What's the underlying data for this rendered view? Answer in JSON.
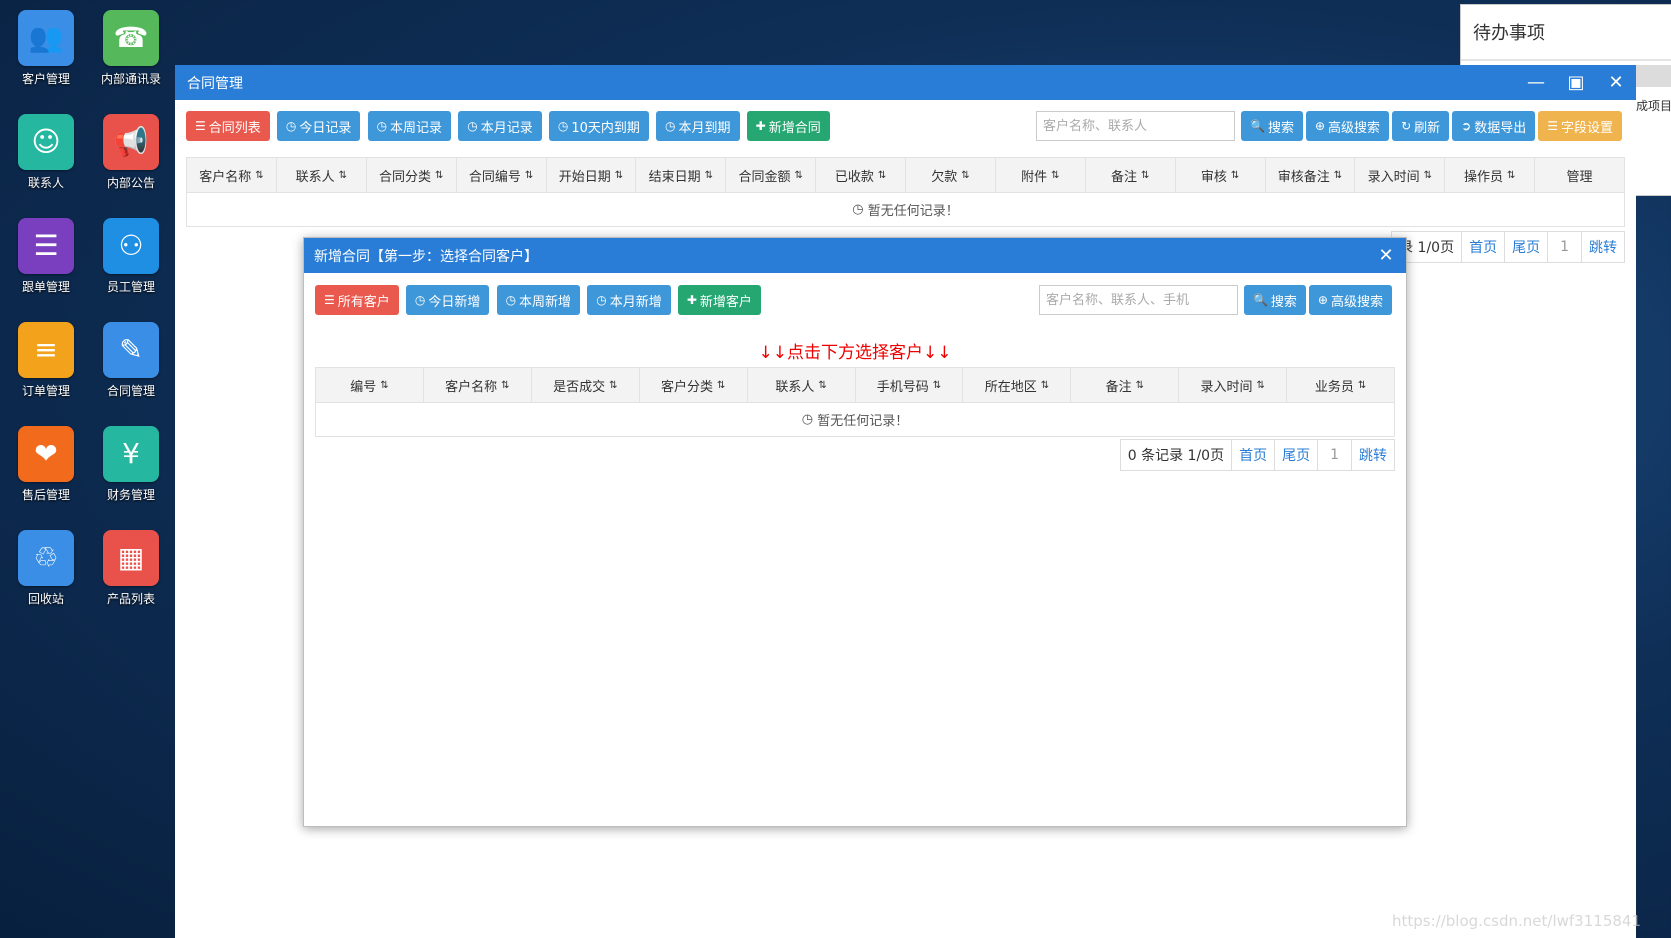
{
  "desktop": {
    "icons": [
      {
        "label": "客户管理",
        "icon": "users-icon",
        "color": "#3a8ee6"
      },
      {
        "label": "内部通讯录",
        "icon": "phonebook-icon",
        "color": "#55b85a"
      },
      {
        "label": "联系人",
        "icon": "contact-icon",
        "color": "#26b7a0"
      },
      {
        "label": "内部公告",
        "icon": "megaphone-icon",
        "color": "#e9514b"
      },
      {
        "label": "跟单管理",
        "icon": "notebook-icon",
        "color": "#7a3fbf"
      },
      {
        "label": "员工管理",
        "icon": "badge-icon",
        "color": "#1e8fe3"
      },
      {
        "label": "订单管理",
        "icon": "list-icon",
        "color": "#f2a21b"
      },
      {
        "label": "合同管理",
        "icon": "contract-icon",
        "color": "#3a8ee6"
      },
      {
        "label": "售后管理",
        "icon": "handshake-icon",
        "color": "#f26b1d"
      },
      {
        "label": "财务管理",
        "icon": "yen-icon",
        "color": "#26b7a0"
      },
      {
        "label": "回收站",
        "icon": "trash-icon",
        "color": "#3a8ee6"
      },
      {
        "label": "产品列表",
        "icon": "grid-icon",
        "color": "#e9514b"
      }
    ]
  },
  "todo": {
    "title": "待办事项",
    "side_text": "成项目"
  },
  "main_window": {
    "title": "合同管理",
    "toolbar": {
      "buttons": [
        "合同列表",
        "今日记录",
        "本周记录",
        "本月记录",
        "10天内到期",
        "本月到期",
        "新增合同"
      ],
      "search_placeholder": "客户名称、联系人",
      "search": "搜索",
      "advanced": "高级搜索",
      "refresh": "刷新",
      "export": "数据导出",
      "fields": "字段设置"
    },
    "columns": [
      "客户名称",
      "联系人",
      "合同分类",
      "合同编号",
      "开始日期",
      "结束日期",
      "合同金额",
      "已收款",
      "欠款",
      "附件",
      "备注",
      "审核",
      "审核备注",
      "录入时间",
      "操作员",
      "管理"
    ],
    "empty": "暂无任何记录！",
    "pager": {
      "summary": "录 1/0页",
      "first": "首页",
      "last": "尾页",
      "page": "1",
      "jump": "跳转"
    }
  },
  "dialog": {
    "title": "新增合同【第一步：选择合同客户】",
    "toolbar": {
      "buttons": [
        "所有客户",
        "今日新增",
        "本周新增",
        "本月新增",
        "新增客户"
      ],
      "search_placeholder": "客户名称、联系人、手机",
      "search": "搜索",
      "advanced": "高级搜索"
    },
    "hint": "↓↓点击下方选择客户↓↓",
    "columns": [
      "编号",
      "客户名称",
      "是否成交",
      "客户分类",
      "联系人",
      "手机号码",
      "所在地区",
      "备注",
      "录入时间",
      "业务员"
    ],
    "empty": "暂无任何记录！",
    "pager": {
      "summary": "0 条记录 1/0页",
      "first": "首页",
      "last": "尾页",
      "page": "1",
      "jump": "跳转"
    }
  },
  "watermark": "https://blog.csdn.net/lwf3115841"
}
